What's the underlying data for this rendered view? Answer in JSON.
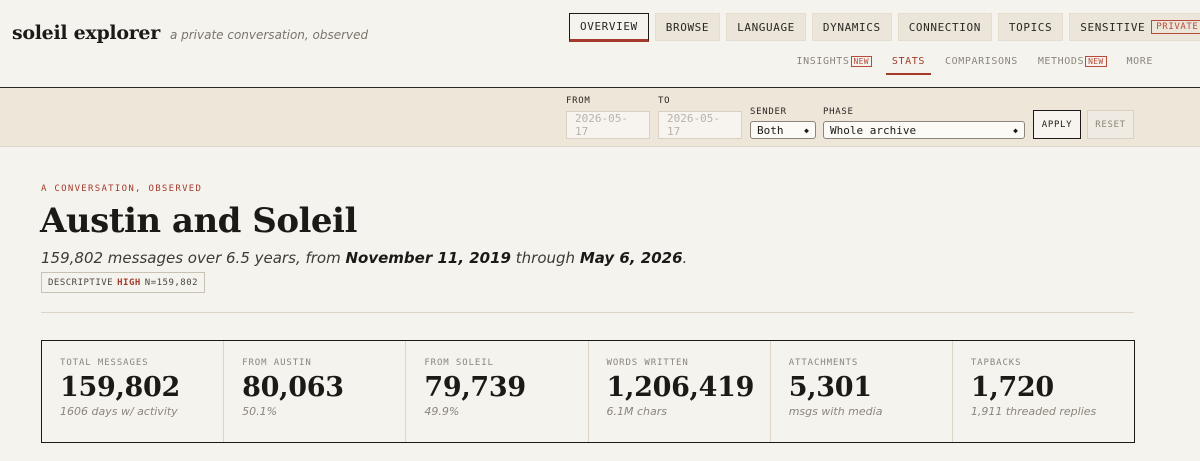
{
  "brand": {
    "name": "soleil explorer",
    "tagline": "a private conversation, observed"
  },
  "primary_nav": [
    {
      "label": "OVERVIEW",
      "active": true
    },
    {
      "label": "BROWSE"
    },
    {
      "label": "LANGUAGE"
    },
    {
      "label": "DYNAMICS"
    },
    {
      "label": "CONNECTION"
    },
    {
      "label": "TOPICS"
    },
    {
      "label": "SENSITIVE",
      "badge": "PRIVATE"
    }
  ],
  "secondary_nav": [
    {
      "label": "INSIGHTS",
      "badge": "NEW"
    },
    {
      "label": "STATS",
      "active": true
    },
    {
      "label": "COMPARISONS"
    },
    {
      "label": "METHODS",
      "badge": "NEW"
    },
    {
      "label": "MORE"
    }
  ],
  "filters": {
    "from_label": "FROM",
    "from_value": "2026-05-17",
    "to_label": "TO",
    "to_value": "2026-05-17",
    "sender_label": "SENDER",
    "sender_value": "Both",
    "phase_label": "PHASE",
    "phase_value": "Whole archive",
    "apply_label": "APPLY",
    "reset_label": "RESET"
  },
  "hero": {
    "eyebrow": "A CONVERSATION, OBSERVED",
    "title": "Austin and Soleil",
    "summary_prefix": "159,802 messages over 6.5 years, from",
    "summary_start": "November 11, 2019",
    "summary_through": "through",
    "summary_end": "May 6, 2026",
    "summary_suffix": ".",
    "badge_kind": "DESCRIPTIVE",
    "badge_level": "HIGH",
    "badge_n": "N=159,802"
  },
  "stats": [
    {
      "label": "TOTAL MESSAGES",
      "value": "159,802",
      "sub": "1606 days w/ activity"
    },
    {
      "label": "FROM AUSTIN",
      "value": "80,063",
      "sub": "50.1%"
    },
    {
      "label": "FROM SOLEIL",
      "value": "79,739",
      "sub": "49.9%"
    },
    {
      "label": "WORDS WRITTEN",
      "value": "1,206,419",
      "sub": "6.1M chars"
    },
    {
      "label": "ATTACHMENTS",
      "value": "5,301",
      "sub": "msgs with media"
    },
    {
      "label": "TAPBACKS",
      "value": "1,720",
      "sub": "1,911 threaded replies"
    }
  ],
  "colors": {
    "accent": "#a33a2c",
    "background": "#f5f3ee",
    "filter_bar": "#ede6d9"
  }
}
